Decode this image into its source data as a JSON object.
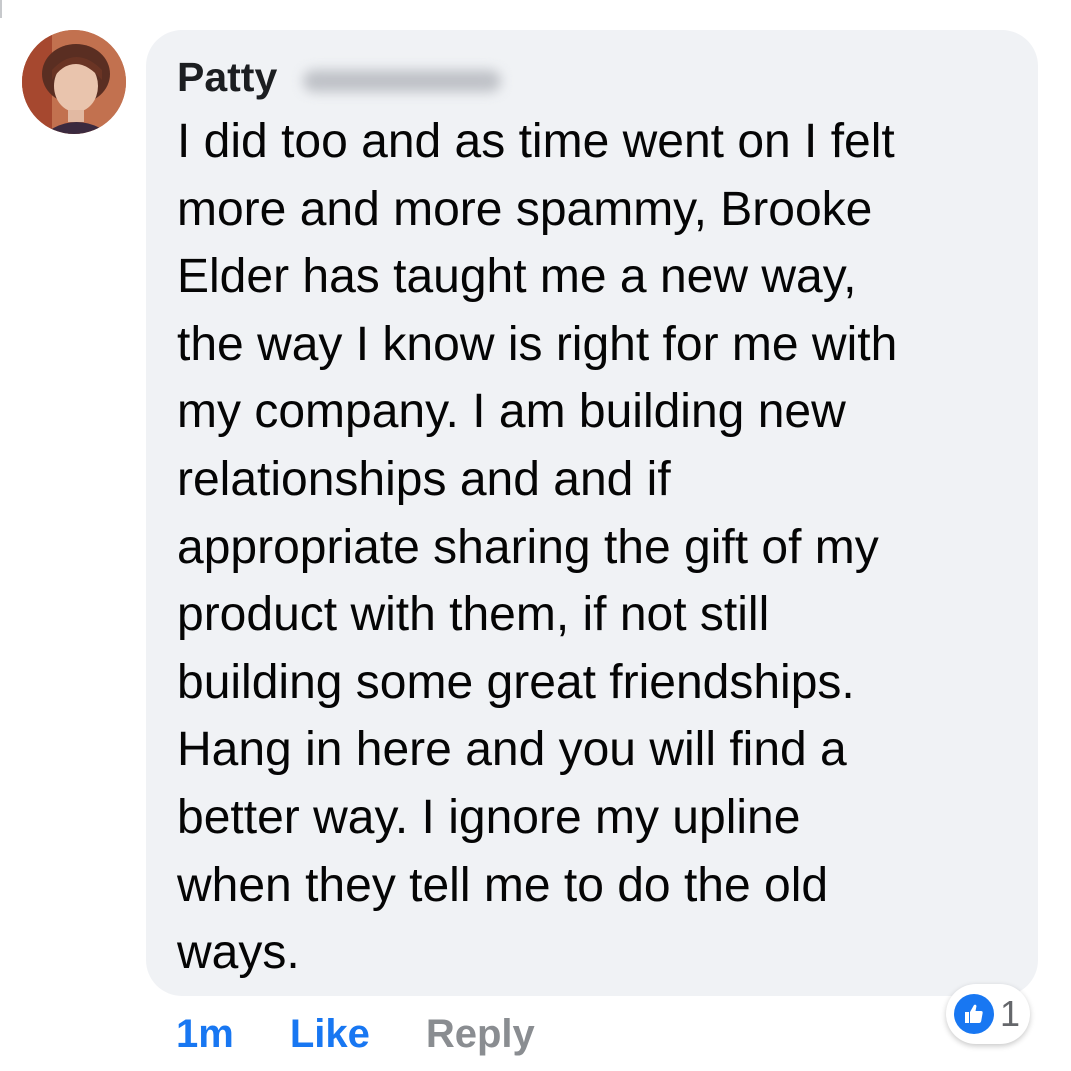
{
  "comment": {
    "author_name": "Patty",
    "text": "I did too and as time went on I felt\nmore and more spammy,  Brooke\nElder has taught me a new way,\nthe way I know is right for me with\nmy company.  I am building new\nrelationships and and if\nappropriate sharing the gift of my\nproduct with them, if not still\nbuilding some great friendships.\nHang in here and you will find a\nbetter way.  I ignore my upline\nwhen they tell me to do the old\nways."
  },
  "actions": {
    "time": "1m",
    "like_label": "Like",
    "reply_label": "Reply"
  },
  "reactions": {
    "icon": "like-thumbs-up-icon",
    "count": "1"
  },
  "colors": {
    "accent": "#1877f2",
    "bubble_bg": "#f0f2f5",
    "muted": "#8a8d91"
  }
}
